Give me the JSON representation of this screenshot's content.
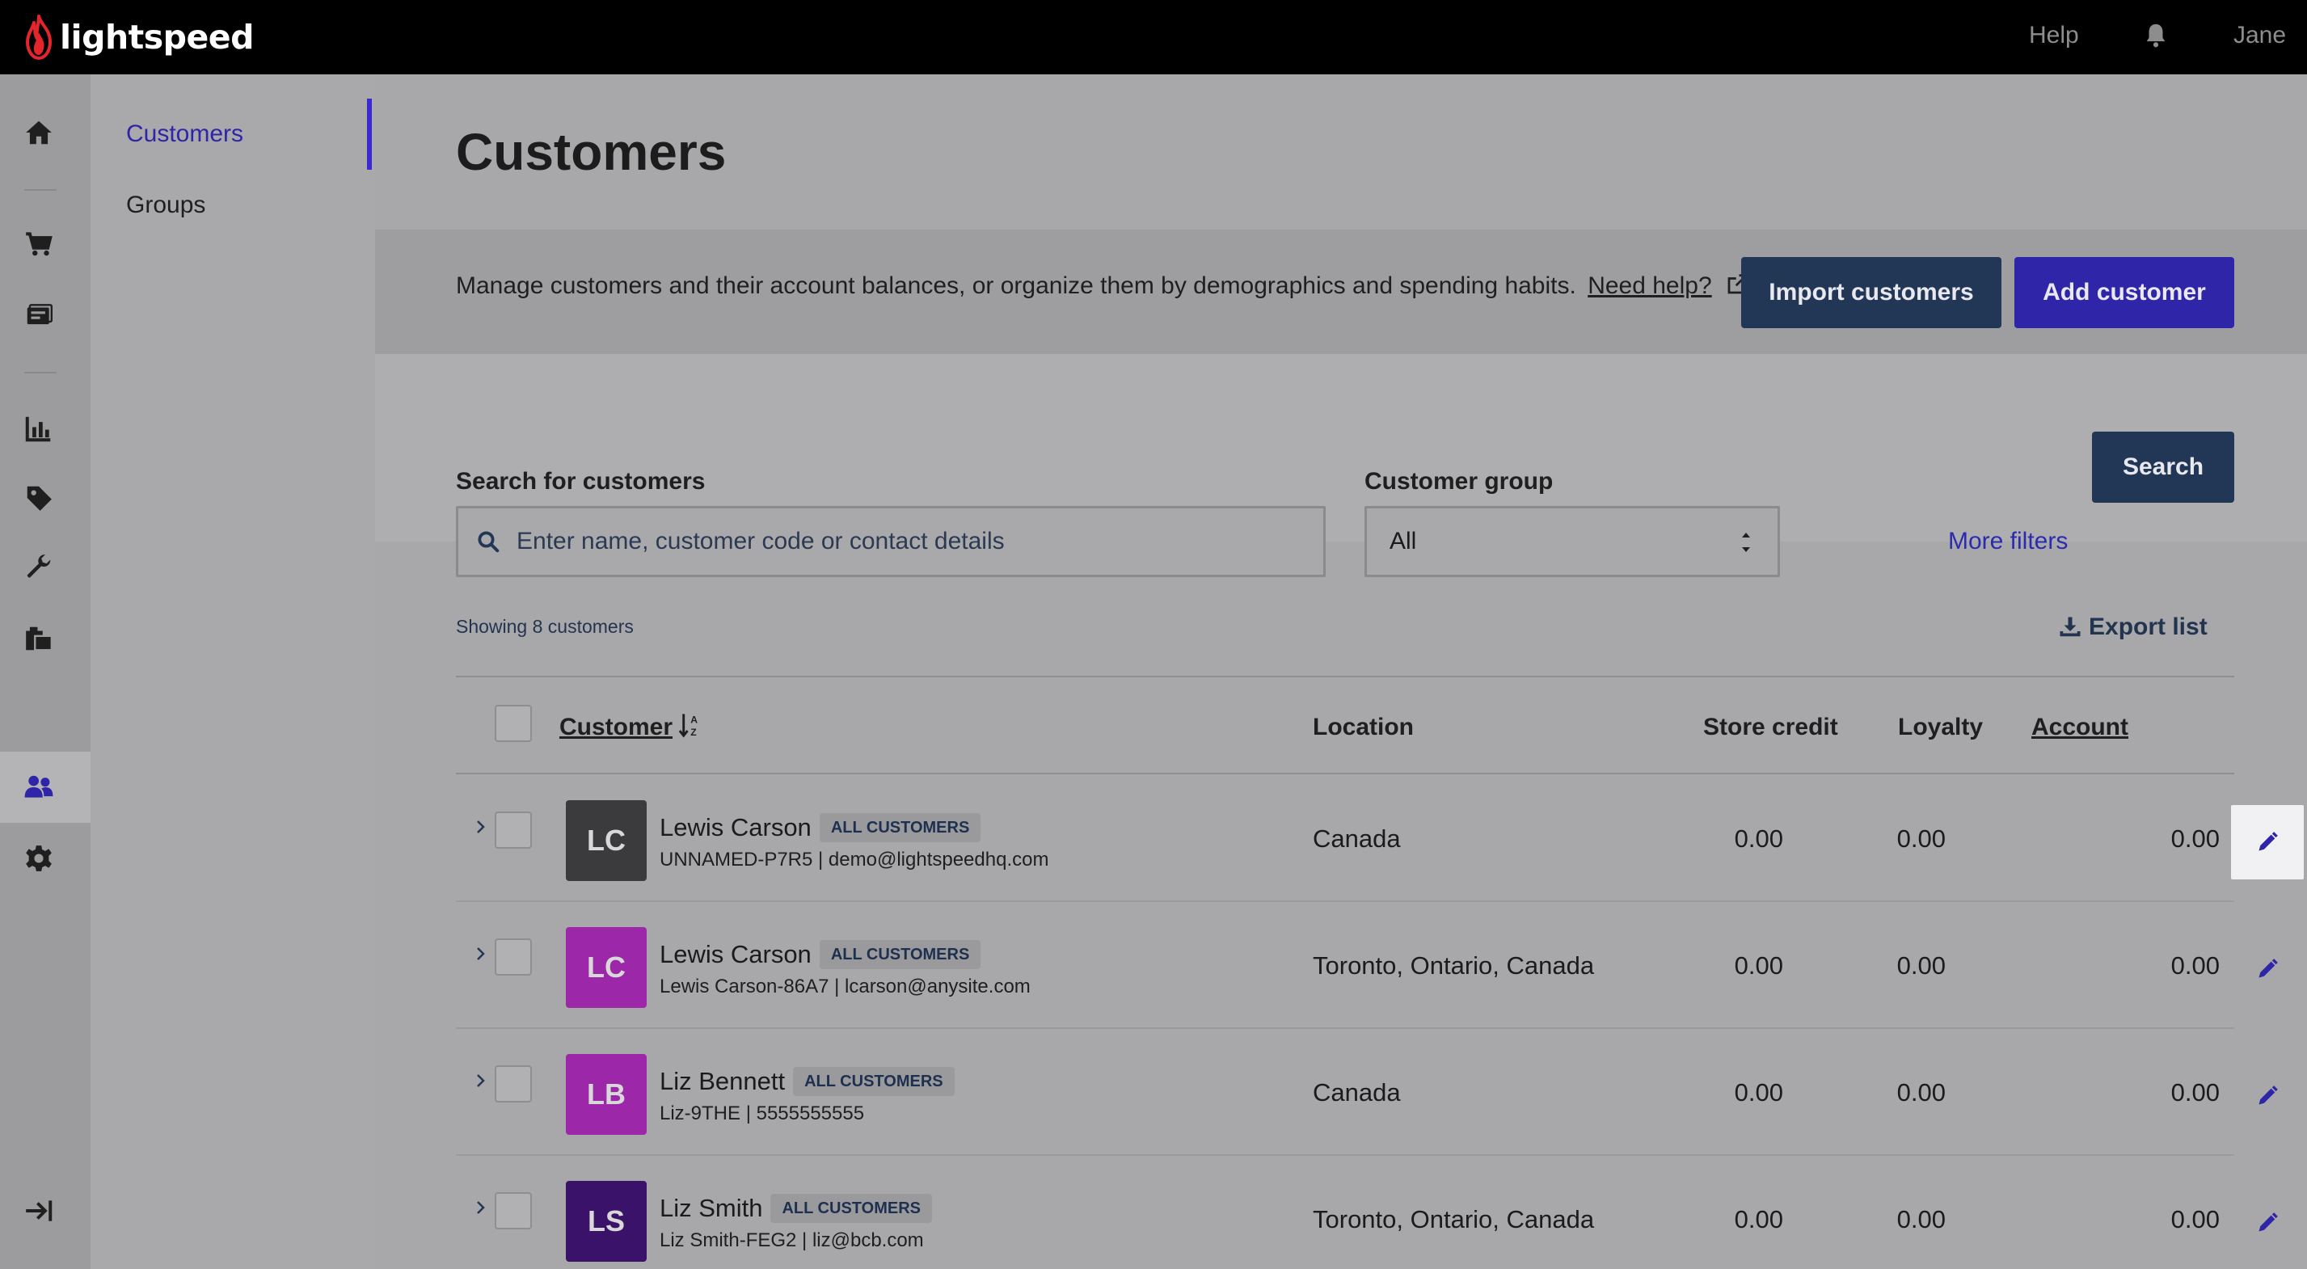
{
  "topbar": {
    "brand": "lightspeed",
    "help": "Help",
    "user": "Jane"
  },
  "rail": {
    "icons": [
      "home-icon",
      "cart-icon",
      "register-icon",
      "reports-icon",
      "tag-icon",
      "wrench-icon",
      "inventory-icon",
      "customers-icon",
      "gear-icon",
      "collapse-icon"
    ]
  },
  "subnav": {
    "items": [
      {
        "label": "Customers",
        "active": true
      },
      {
        "label": "Groups",
        "active": false
      }
    ]
  },
  "page": {
    "title": "Customers",
    "description": "Manage customers and their account balances, or organize them by demographics and spending habits.",
    "help_link": "Need help?",
    "import_label": "Import customers",
    "add_label": "Add customer"
  },
  "filters": {
    "search_label": "Search for customers",
    "search_placeholder": "Enter name, customer code or contact details",
    "group_label": "Customer group",
    "group_value": "All",
    "more_filters": "More filters",
    "search_button": "Search"
  },
  "list": {
    "showing": "Showing 8 customers",
    "export": "Export list",
    "columns": {
      "customer": "Customer",
      "location": "Location",
      "store_credit": "Store credit",
      "loyalty": "Loyalty",
      "account": "Account"
    },
    "rows": [
      {
        "initials": "LC",
        "avatar_color": "#3b3b3d",
        "name": "Lewis Carson",
        "badge": "ALL CUSTOMERS",
        "sub": "UNNAMED-P7R5 | demo@lightspeedhq.com",
        "location": "Canada",
        "store_credit": "0.00",
        "loyalty": "0.00",
        "account": "0.00"
      },
      {
        "initials": "LC",
        "avatar_color": "#9c27a8",
        "name": "Lewis Carson",
        "badge": "ALL CUSTOMERS",
        "sub": "Lewis Carson-86A7 | lcarson@anysite.com",
        "location": "Toronto, Ontario, Canada",
        "store_credit": "0.00",
        "loyalty": "0.00",
        "account": "0.00"
      },
      {
        "initials": "LB",
        "avatar_color": "#9c27a8",
        "name": "Liz Bennett",
        "badge": "ALL CUSTOMERS",
        "sub": "Liz-9THE | 5555555555",
        "location": "Canada",
        "store_credit": "0.00",
        "loyalty": "0.00",
        "account": "0.00"
      },
      {
        "initials": "LS",
        "avatar_color": "#3a126a",
        "name": "Liz Smith",
        "badge": "ALL CUSTOMERS",
        "sub": "Liz Smith-FEG2 | liz@bcb.com",
        "location": "Toronto, Ontario, Canada",
        "store_credit": "0.00",
        "loyalty": "0.00",
        "account": "0.00"
      }
    ]
  },
  "colors": {
    "accent": "#2f25a8",
    "navy": "#223755",
    "link": "#2b2bb0"
  }
}
